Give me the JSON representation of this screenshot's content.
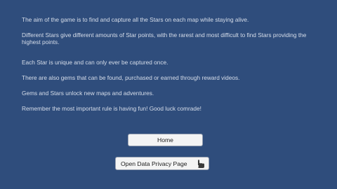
{
  "instructions": {
    "p1": "The aim of the game is to find and capture all the Stars on each map while staying alive.",
    "p2": "Different Stars give different amounts of Star points, with the rarest and most difficult to find Stars  providing the highest points.",
    "p3": "Each Star is unique and can only ever be captured once.",
    "p4": "There are also gems that can be found, purchased or earned through reward videos.",
    "p5": "Gems and Stars unlock new maps and adventures.",
    "p6": "Remember the most important rule is having fun! Good luck comrade!"
  },
  "buttons": {
    "home_label": "Home",
    "privacy_label": "Open Data Privacy Page",
    "privacy_icon": "pointing-hand-icon"
  },
  "colors": {
    "background": "#2f4d7c",
    "text": "#d7deea",
    "button_bg": "#f4f4f4"
  }
}
